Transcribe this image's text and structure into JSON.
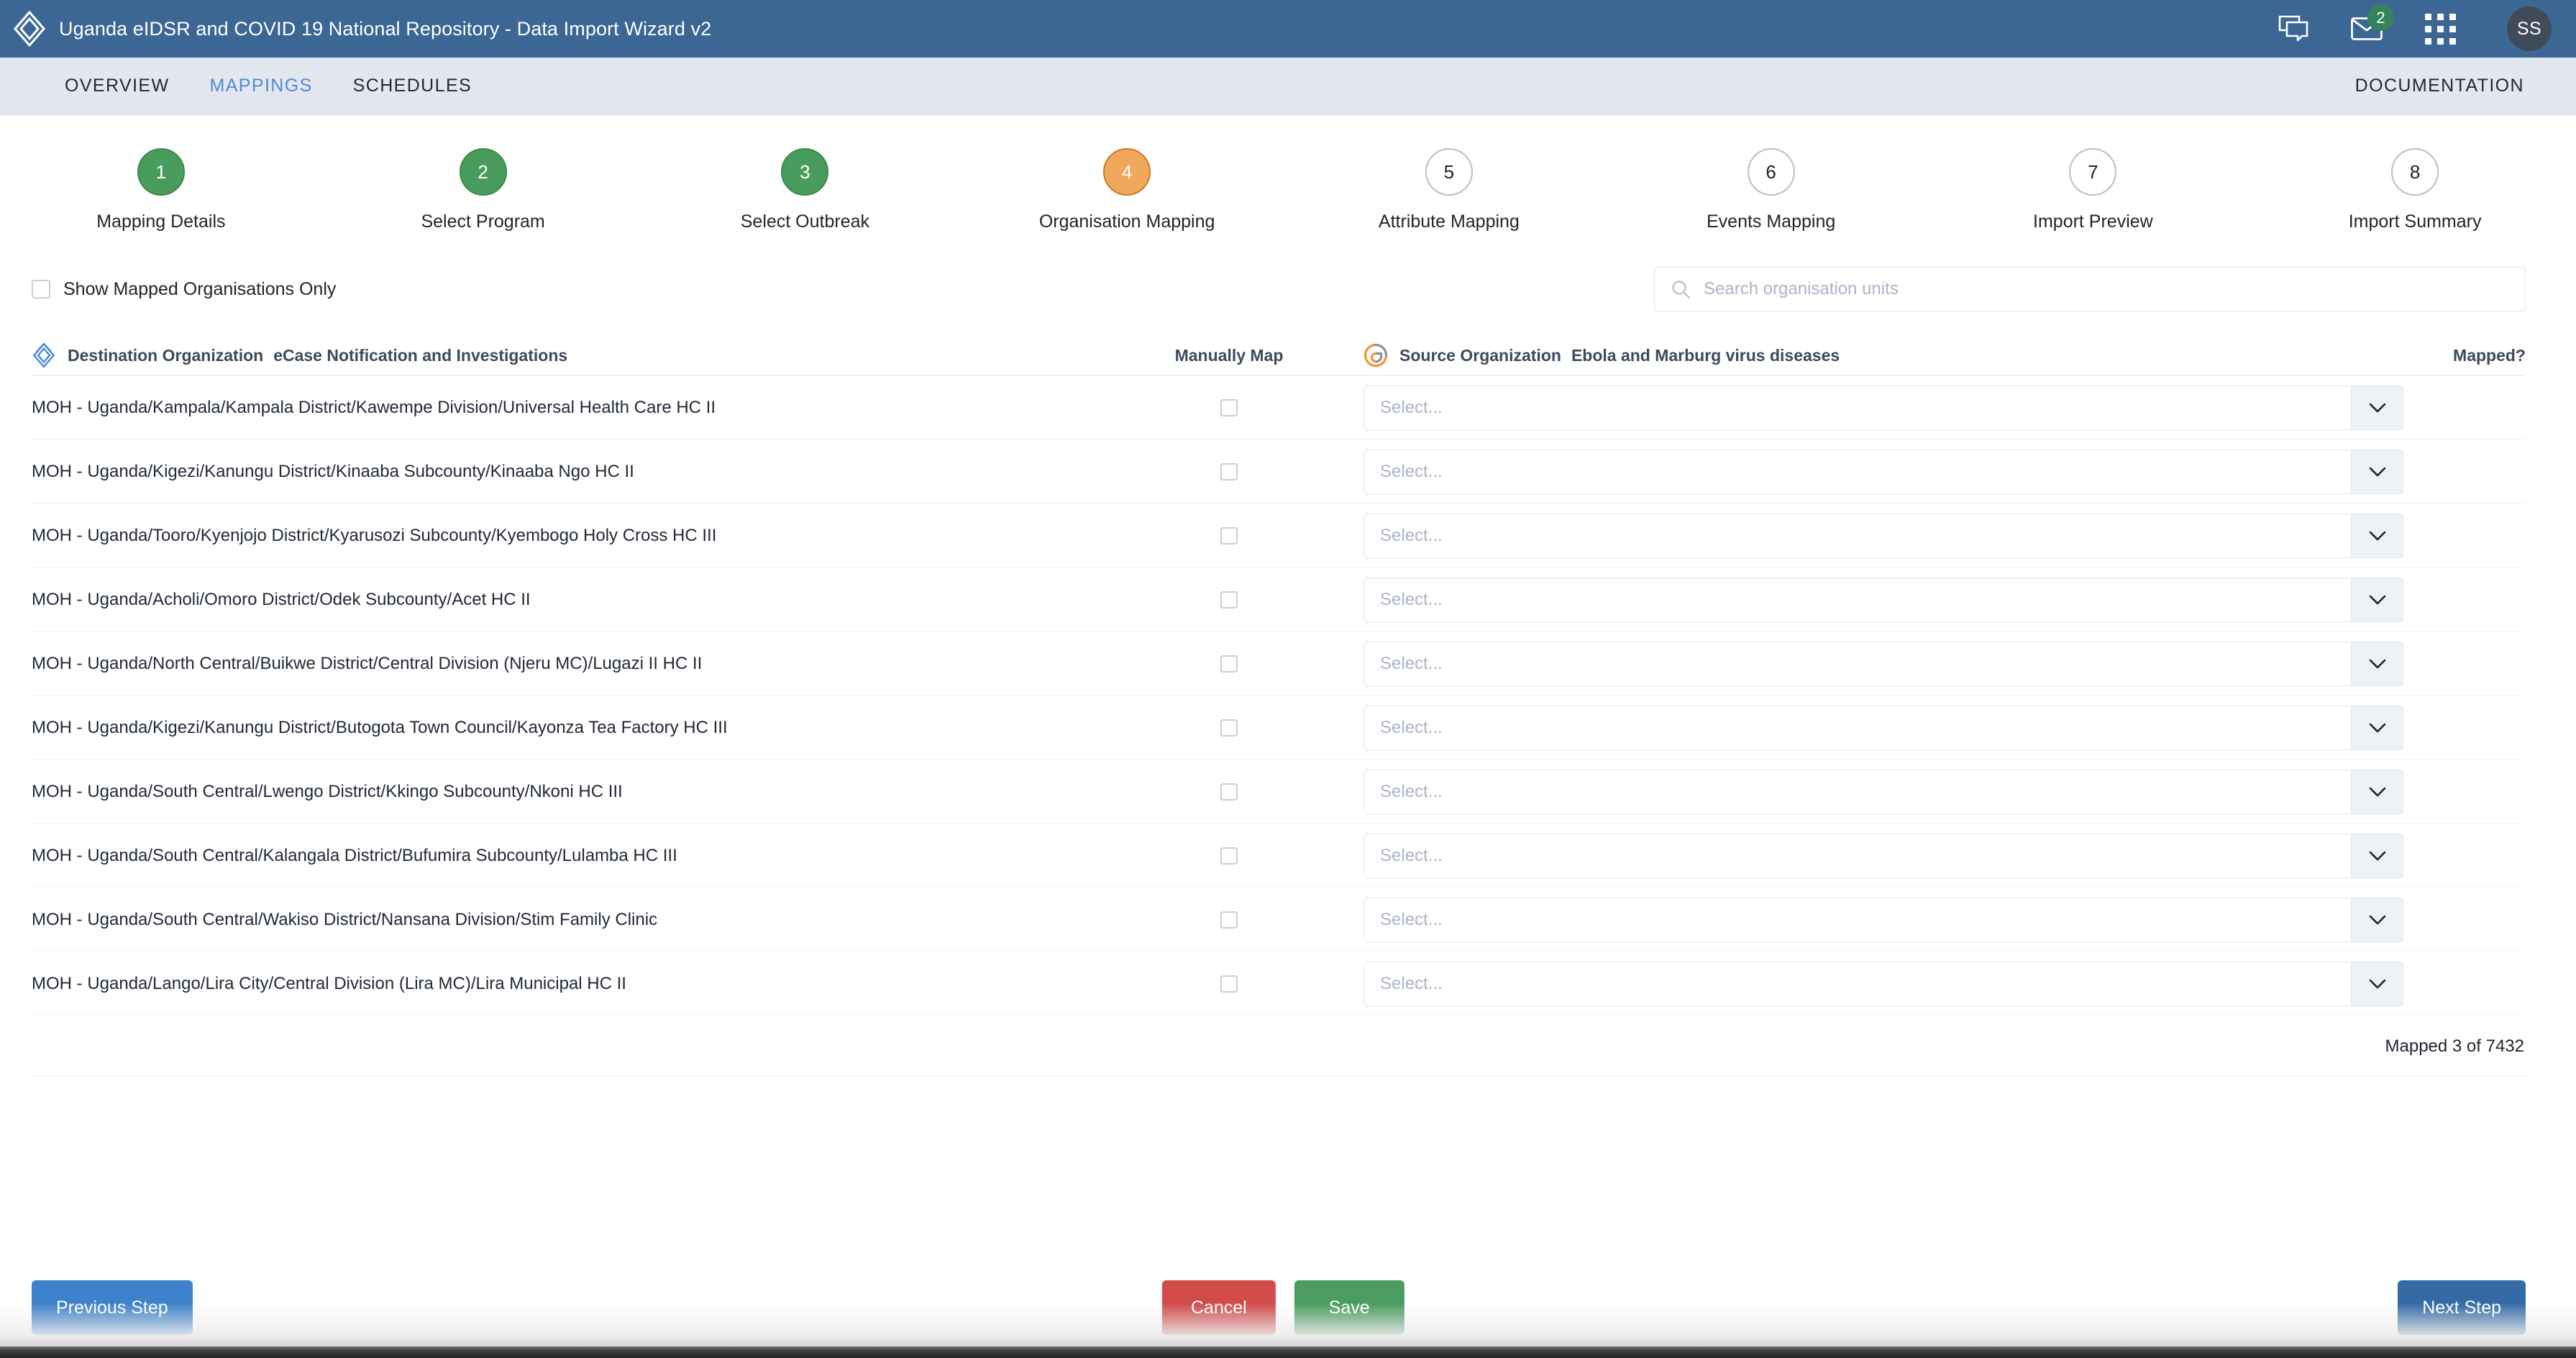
{
  "header": {
    "logo_icon": "dhis2-diamond-logo",
    "title": "Uganda eIDSR and COVID 19 National Repository - Data Import Wizard v2",
    "icons": [
      {
        "name": "messages-icon",
        "label": "Messages"
      },
      {
        "name": "mail-icon",
        "label": "Mail",
        "badge": "2"
      },
      {
        "name": "apps-grid-icon",
        "label": "Apps"
      }
    ],
    "avatar_initials": "SS"
  },
  "tabs": [
    {
      "label": "OVERVIEW",
      "active": false
    },
    {
      "label": "MAPPINGS",
      "active": true
    },
    {
      "label": "SCHEDULES",
      "active": false
    }
  ],
  "documentation_link": "DOCUMENTATION",
  "stepper": [
    {
      "number": "1",
      "label": "Mapping Details",
      "state": "done"
    },
    {
      "number": "2",
      "label": "Select Program",
      "state": "done"
    },
    {
      "number": "3",
      "label": "Select Outbreak",
      "state": "done"
    },
    {
      "number": "4",
      "label": "Organisation Mapping",
      "state": "current"
    },
    {
      "number": "5",
      "label": "Attribute Mapping",
      "state": "todo"
    },
    {
      "number": "6",
      "label": "Events Mapping",
      "state": "todo"
    },
    {
      "number": "7",
      "label": "Import Preview",
      "state": "todo"
    },
    {
      "number": "8",
      "label": "Import Summary",
      "state": "todo"
    }
  ],
  "filters": {
    "show_mapped_label": "Show Mapped Organisations Only",
    "show_mapped_checked": false,
    "search_placeholder": "Search organisation units",
    "search_value": "",
    "search_icon": "search-icon"
  },
  "table": {
    "headers": {
      "destination": "Destination Organization",
      "destination_program": "eCase Notification and Investigations",
      "destination_icon": "dhis2-diamond-logo",
      "manually_map": "Manually Map",
      "source": "Source Organization",
      "source_program": "Ebola and Marburg virus diseases",
      "source_icon": "godata-g-icon",
      "mapped": "Mapped?"
    },
    "select_placeholder": "Select...",
    "chevron_icon": "chevron-down-icon",
    "rows": [
      {
        "destination": "MOH - Uganda/Kampala/Kampala District/Kawempe Division/Universal Health Care HC II",
        "manually_map": false,
        "source": ""
      },
      {
        "destination": "MOH - Uganda/Kigezi/Kanungu District/Kinaaba Subcounty/Kinaaba Ngo HC II",
        "manually_map": false,
        "source": ""
      },
      {
        "destination": "MOH - Uganda/Tooro/Kyenjojo District/Kyarusozi Subcounty/Kyembogo Holy Cross HC III",
        "manually_map": false,
        "source": ""
      },
      {
        "destination": "MOH - Uganda/Acholi/Omoro District/Odek Subcounty/Acet HC II",
        "manually_map": false,
        "source": ""
      },
      {
        "destination": "MOH - Uganda/North Central/Buikwe District/Central Division (Njeru MC)/Lugazi II HC II",
        "manually_map": false,
        "source": ""
      },
      {
        "destination": "MOH - Uganda/Kigezi/Kanungu District/Butogota Town Council/Kayonza Tea Factory HC III",
        "manually_map": false,
        "source": ""
      },
      {
        "destination": "MOH - Uganda/South Central/Lwengo District/Kkingo Subcounty/Nkoni HC III",
        "manually_map": false,
        "source": ""
      },
      {
        "destination": "MOH - Uganda/South Central/Kalangala District/Bufumira Subcounty/Lulamba HC III",
        "manually_map": false,
        "source": ""
      },
      {
        "destination": "MOH - Uganda/South Central/Wakiso District/Nansana Division/Stim Family Clinic",
        "manually_map": false,
        "source": ""
      },
      {
        "destination": "MOH - Uganda/Lango/Lira City/Central Division (Lira MC)/Lira Municipal HC II",
        "manually_map": false,
        "source": ""
      }
    ],
    "mapped_summary": "Mapped 3 of 7432"
  },
  "footer": {
    "previous_step": "Previous Step",
    "cancel": "Cancel",
    "save": "Save",
    "next_step": "Next Step"
  },
  "colors": {
    "header_blue": "#3c6694",
    "tab_active": "#4e8bd4",
    "step_done": "#4a9c5d",
    "step_current": "#efa85c",
    "cancel_red": "#d24b4b",
    "save_green": "#4a9c61",
    "button_blue": "#3d82ca",
    "badge_green": "#35835c"
  }
}
